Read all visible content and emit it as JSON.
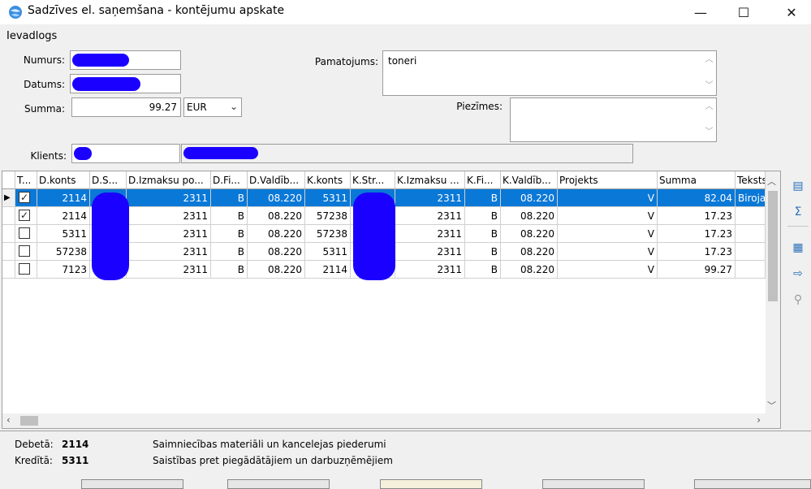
{
  "window": {
    "title": "Sadzīves el. saņemšana - kontējumu apskate",
    "minimize": "—",
    "maximize": "☐",
    "close": "✕"
  },
  "menu": {
    "items": [
      "Ievadlogs"
    ]
  },
  "form": {
    "numurs_label": "Numurs:",
    "datums_label": "Datums:",
    "summa_label": "Summa:",
    "summa_value": "99.27",
    "currency_value": "EUR",
    "klients_label": "Klients:",
    "pamatojums_label": "Pamatojums:",
    "pamatojums_value": "toneri",
    "piezimes_label": "Piezīmes:"
  },
  "grid": {
    "headers": [
      "T...",
      "D.konts",
      "D.S...",
      "D.Izmaksu po...",
      "D.Fi...",
      "D.Valdīb...",
      "K.konts",
      "K.Str...",
      "K.Izmaksu ...",
      "K.Fi...",
      "K.Valdīb...",
      "Projekts",
      "Summa",
      "Teksts"
    ],
    "rows": [
      {
        "checked": true,
        "d_konts": "2114",
        "d_s": "",
        "d_izm": "2311",
        "d_fi": "B",
        "d_vald": "08.220",
        "k_konts": "5311",
        "k_str": "",
        "k_izm": "2311",
        "k_fi": "B",
        "k_vald": "08.220",
        "projekts": "V",
        "summa": "82.04",
        "teksts": "Biroja",
        "selected": true
      },
      {
        "checked": true,
        "d_konts": "2114",
        "d_s": "",
        "d_izm": "2311",
        "d_fi": "B",
        "d_vald": "08.220",
        "k_konts": "57238",
        "k_str": "",
        "k_izm": "2311",
        "k_fi": "B",
        "k_vald": "08.220",
        "projekts": "V",
        "summa": "17.23",
        "teksts": "",
        "selected": false
      },
      {
        "checked": false,
        "d_konts": "5311",
        "d_s": "",
        "d_izm": "2311",
        "d_fi": "B",
        "d_vald": "08.220",
        "k_konts": "57238",
        "k_str": "",
        "k_izm": "2311",
        "k_fi": "B",
        "k_vald": "08.220",
        "projekts": "V",
        "summa": "17.23",
        "teksts": "",
        "selected": false
      },
      {
        "checked": false,
        "d_konts": "57238",
        "d_s": "",
        "d_izm": "2311",
        "d_fi": "B",
        "d_vald": "08.220",
        "k_konts": "5311",
        "k_str": "",
        "k_izm": "2311",
        "k_fi": "B",
        "k_vald": "08.220",
        "projekts": "V",
        "summa": "17.23",
        "teksts": "",
        "selected": false
      },
      {
        "checked": false,
        "d_konts": "7123",
        "d_s": "",
        "d_izm": "2311",
        "d_fi": "B",
        "d_vald": "08.220",
        "k_konts": "2114",
        "k_str": "",
        "k_izm": "2311",
        "k_fi": "B",
        "k_vald": "08.220",
        "projekts": "V",
        "summa": "99.27",
        "teksts": "",
        "selected": false
      }
    ]
  },
  "footer": {
    "debeta_label": "Debetā:",
    "debeta_value": "2114",
    "debeta_desc": "Saimniecības materiāli un kancelejas piederumi",
    "kredita_label": "Kredītā:",
    "kredita_value": "5311",
    "kredita_desc": "Saistības pret piegādātājiem un darbuzņēmējiem"
  },
  "colors": {
    "selection": "#0a78d7",
    "redaction": "#1a00ff",
    "toolbar_icon": "#2a6fb8"
  }
}
